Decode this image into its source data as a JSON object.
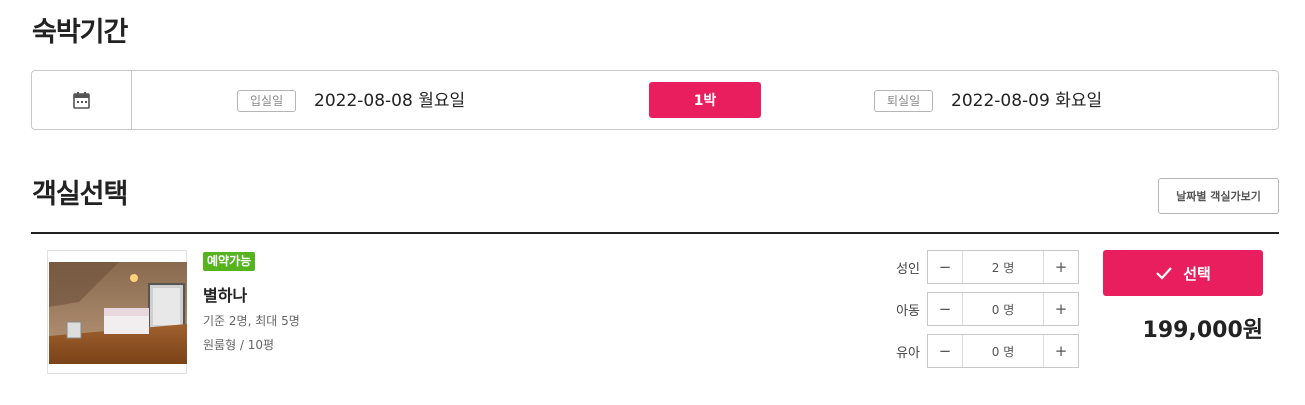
{
  "stay": {
    "title": "숙박기간",
    "checkin_tag": "입실일",
    "checkin_date": "2022-08-08 월요일",
    "nights": "1박",
    "checkout_tag": "퇴실일",
    "checkout_date": "2022-08-09 화요일"
  },
  "rooms_section": {
    "title": "객실선택",
    "date_view_button": "날짜별 객실가보기"
  },
  "room": {
    "badge": "예약가능",
    "name": "별하나",
    "capacity": "기준 2명, 최대 5명",
    "type": "원룸형 / 10평",
    "price": "199,000원",
    "select_label": "선택",
    "guests": [
      {
        "label": "성인",
        "value": "2 명"
      },
      {
        "label": "아동",
        "value": "0 명"
      },
      {
        "label": "유아",
        "value": "0 명"
      }
    ],
    "stepper_minus": "−",
    "stepper_plus": "+"
  },
  "colors": {
    "accent": "#e81e5e",
    "available_badge": "#55b41e"
  },
  "icons": [
    "calendar-icon",
    "check-icon"
  ]
}
